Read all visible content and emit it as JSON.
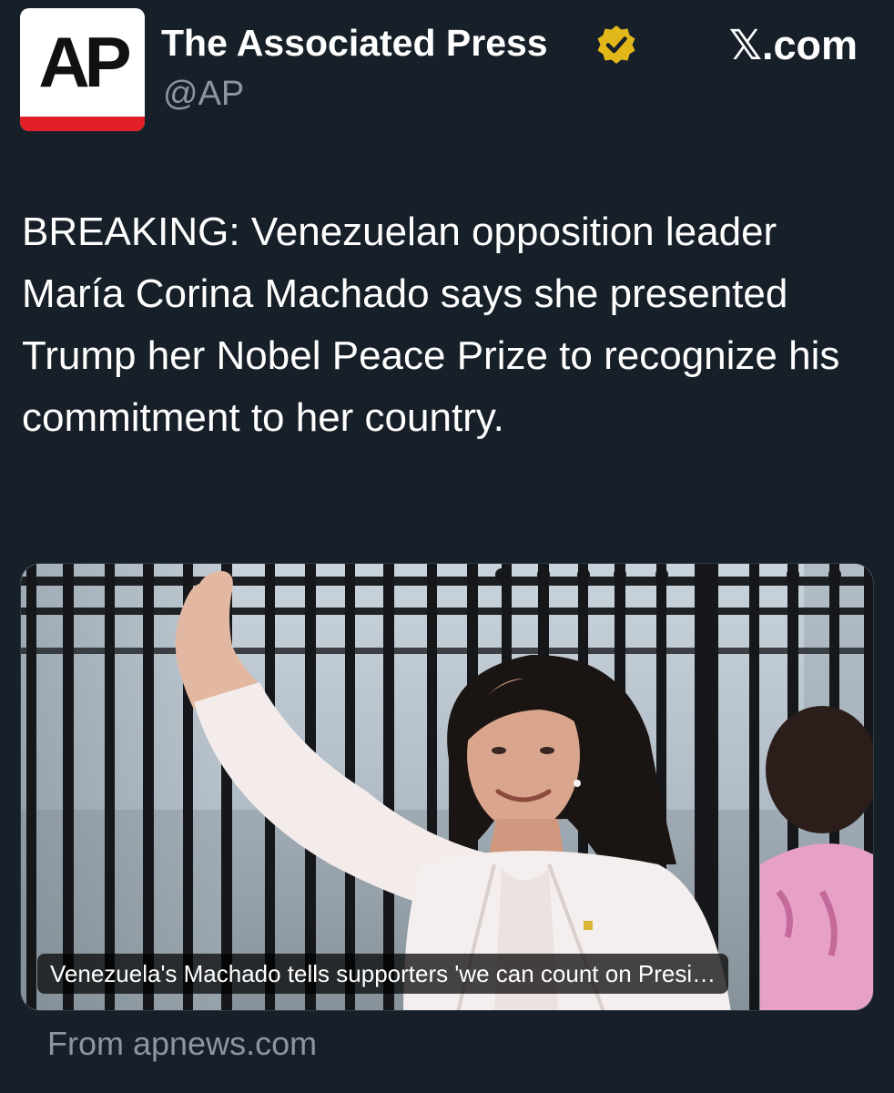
{
  "header": {
    "avatar_text": "AP",
    "display_name": "The Associated Press",
    "handle": "@AP",
    "site_logo_mark": "𝕏",
    "site_logo_text": ".com",
    "verified_icon": "gold-verified-badge-icon"
  },
  "tweet": {
    "text": "BREAKING: Venezuelan opposition leader María Corina Machado says she presented Trump her Nobel Peace Prize to recognize his commitment to her country."
  },
  "media": {
    "caption": "Venezuela's Machado tells supporters 'we can count on Presi…",
    "source": "From apnews.com"
  },
  "colors": {
    "background": "#172029",
    "text": "#ffffff",
    "secondary_text": "#8b96a1",
    "verified_gold": "#e2b719",
    "ap_red": "#e21f26"
  }
}
